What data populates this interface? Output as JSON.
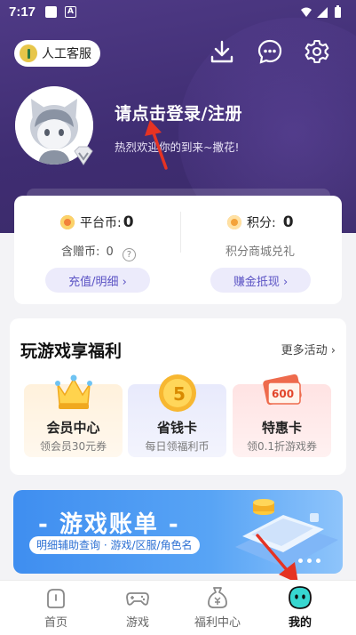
{
  "status_bar": {
    "time": "7:17",
    "a_label": "A"
  },
  "header": {
    "customer_service_label": "人工客服"
  },
  "profile": {
    "login_title": "请点击登录/注册",
    "welcome_text": "热烈欢迎你的到来~撒花!"
  },
  "wallet": {
    "platform_coin_label": "平台币:",
    "platform_coin_value": "0",
    "points_label": "积分:",
    "points_value": "0",
    "gift_coin_label": "含赠币:",
    "gift_coin_value": "0",
    "gift_help": "?",
    "points_shop_label": "积分商城兑礼",
    "recharge_button": "充值/明细 ›",
    "earn_button": "赚金抵现 ›"
  },
  "welfare": {
    "title": "玩游戏享福利",
    "more_label": "更多活动 ›",
    "tiles": [
      {
        "title": "会员中心",
        "subtitle": "领会员30元券"
      },
      {
        "title": "省钱卡",
        "subtitle": "每日领福利币",
        "badge": "5"
      },
      {
        "title": "特惠卡",
        "subtitle": "领0.1折游戏券",
        "badge": "600"
      }
    ]
  },
  "banner": {
    "title": "- 游戏账单 -",
    "subtitle": "明细辅助查询 · 游戏/区服/角色名"
  },
  "tabs": [
    {
      "label": "首页",
      "icon": "home-icon"
    },
    {
      "label": "游戏",
      "icon": "gamepad-icon"
    },
    {
      "label": "福利中心",
      "icon": "money-bag-icon"
    },
    {
      "label": "我的",
      "icon": "mine-face-icon",
      "active": true
    }
  ],
  "colors": {
    "hero": "#4f3a86",
    "accent": "#5a52c4",
    "banner": "#3f8ef0",
    "arrow": "#e53323",
    "tab_active": "#37d7d0"
  }
}
